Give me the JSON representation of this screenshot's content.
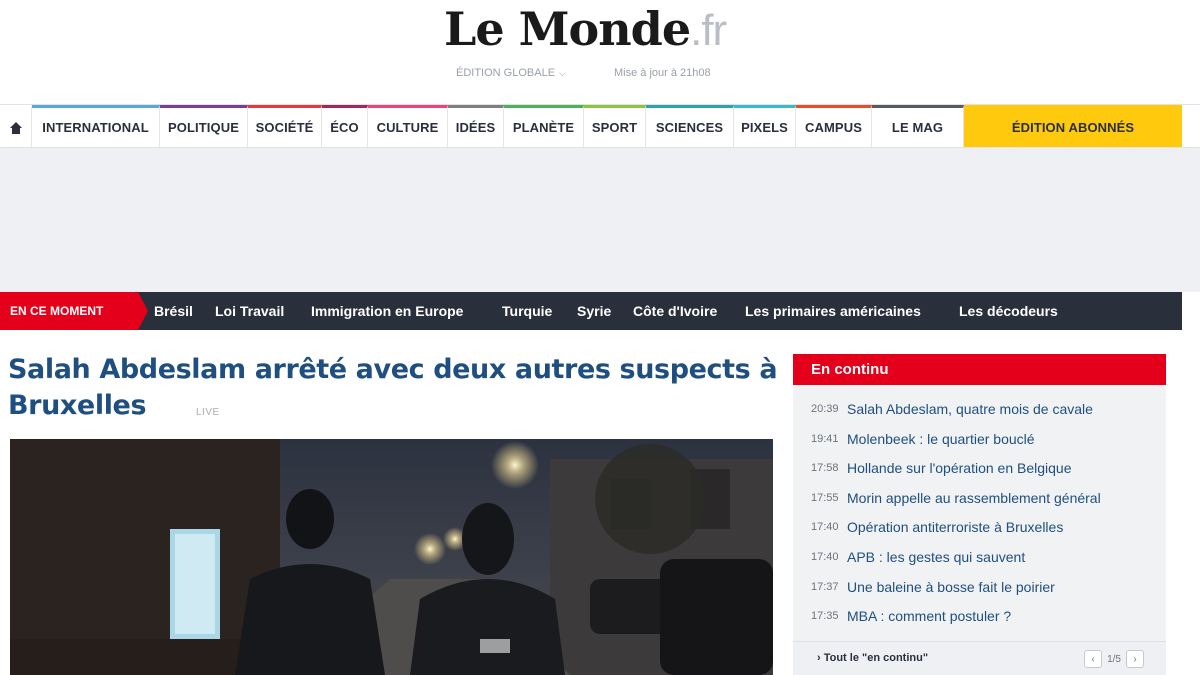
{
  "header": {
    "logo_main": "Le Monde",
    "logo_tld": ".fr",
    "edition": "ÉDITION GLOBALE",
    "updated": "Mise à jour à 21h08"
  },
  "nav": {
    "home_icon": "home-icon",
    "items": [
      {
        "label": "INTERNATIONAL",
        "color": "#56a9d8"
      },
      {
        "label": "POLITIQUE",
        "color": "#7a3f8f"
      },
      {
        "label": "SOCIÉTÉ",
        "color": "#e23b3b"
      },
      {
        "label": "ÉCO",
        "color": "#9b2b5d"
      },
      {
        "label": "CULTURE",
        "color": "#e8457f"
      },
      {
        "label": "IDÉES",
        "color": "#7f7f7f"
      },
      {
        "label": "PLANÈTE",
        "color": "#4db05a"
      },
      {
        "label": "SPORT",
        "color": "#8cc63e"
      },
      {
        "label": "SCIENCES",
        "color": "#2aa6a6"
      },
      {
        "label": "PIXELS",
        "color": "#3bb8c9"
      },
      {
        "label": "CAMPUS",
        "color": "#e64d2c"
      },
      {
        "label": "LE MAG",
        "color": "#555a63"
      }
    ],
    "abonnes": "ÉDITION ABONNÉS",
    "abonnes_color": "#ffc90e"
  },
  "moment": {
    "label": "EN CE MOMENT",
    "links": [
      "Brésil",
      "Loi Travail",
      "Immigration en Europe",
      "Turquie",
      "Syrie",
      "Côte d'Ivoire",
      "Les primaires américaines",
      "Les décodeurs"
    ]
  },
  "article": {
    "headline": "Salah Abdeslam arrêté avec deux autres suspects à Bruxelles",
    "live": "LIVE"
  },
  "en_continu": {
    "title": "En continu",
    "items": [
      {
        "time": "20:39",
        "title": "Salah Abdeslam, quatre mois de cavale"
      },
      {
        "time": "19:41",
        "title": "Molenbeek : le quartier bouclé"
      },
      {
        "time": "17:58",
        "title": "Hollande sur l'opération en Belgique"
      },
      {
        "time": "17:55",
        "title": "Morin appelle au rassemblement général"
      },
      {
        "time": "17:40",
        "title": "Opération antiterroriste à Bruxelles"
      },
      {
        "time": "17:40",
        "title": "APB : les gestes qui sauvent"
      },
      {
        "time": "17:37",
        "title": "Une baleine à bosse fait le poirier"
      },
      {
        "time": "17:35",
        "title": "MBA : comment postuler ?"
      }
    ],
    "all_link": "› Tout le \"en continu\"",
    "pager": "1/5"
  }
}
